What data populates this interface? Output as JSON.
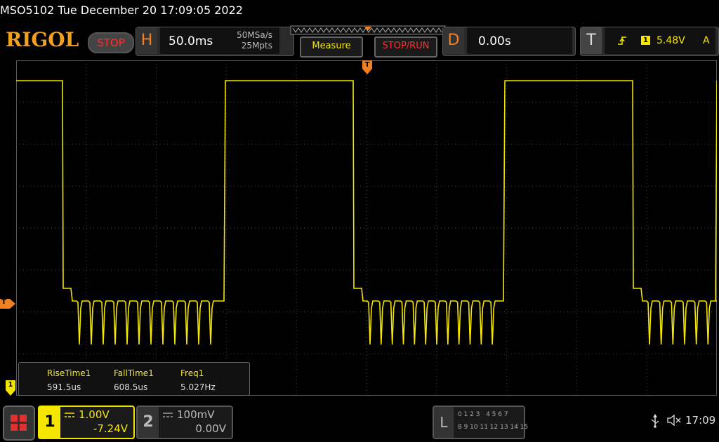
{
  "header": {
    "title": "MSO5102  Tue December 20 17:09:05 2022",
    "logo": "RIGOL",
    "stop_label": "STOP",
    "horizontal": {
      "letter": "H",
      "timebase": "50.0ms",
      "sample_rate": "50MSa/s",
      "memory_depth": "25Mpts"
    },
    "measure_label": "Measure",
    "stop_run_label": "STOP/RUN",
    "delay": {
      "letter": "D",
      "value": "0.00s"
    },
    "trigger": {
      "letter": "T",
      "source": "1",
      "level": "5.48V",
      "mode": "A"
    }
  },
  "waveform": {
    "trigger_marker": "T",
    "channel_marker": "1",
    "trace_color": "#f5e600"
  },
  "measurements": {
    "items": [
      {
        "label": "RiseTime1",
        "value": "591.5us"
      },
      {
        "label": "FallTime1",
        "value": "608.5us"
      },
      {
        "label": "Freq1",
        "value": "5.027Hz"
      }
    ]
  },
  "footer": {
    "channel1": {
      "number": "1",
      "scale": "1.00V",
      "offset": "-7.24V"
    },
    "channel2": {
      "number": "2",
      "scale": "100mV",
      "offset": "0.00V"
    },
    "logic": {
      "letter": "L",
      "row1": "0 1 2 3   4 5 6 7",
      "row2": "8 9 10 11 12 13 14 15"
    },
    "time": "17:09"
  }
}
